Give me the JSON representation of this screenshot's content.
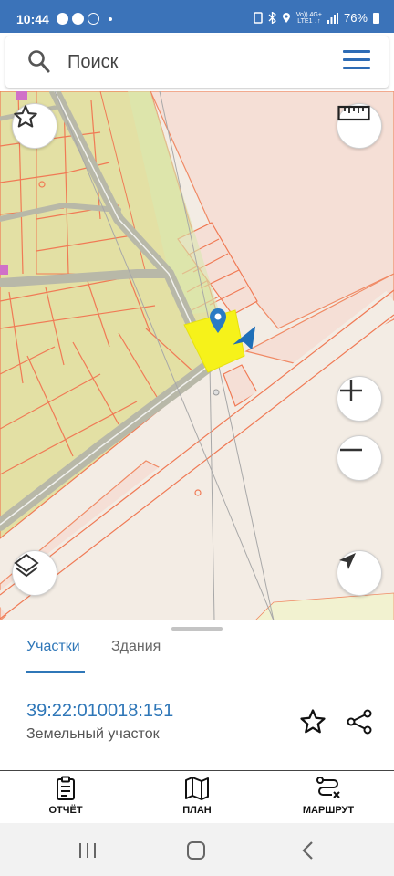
{
  "status_bar": {
    "time": "10:44",
    "lte_top": "Vo)) 4G+",
    "lte_bottom": "LTE1 ↓↑",
    "battery": "76%"
  },
  "search": {
    "placeholder": "Поиск"
  },
  "map": {
    "buttons": {
      "favorite": "star-icon",
      "ruler": "ruler-icon",
      "zoom_in": "plus-icon",
      "zoom_out": "minus-icon",
      "layers": "layers-icon",
      "my_location": "navigation-arrow-icon"
    },
    "colors": {
      "parcel_fill": "#e3e0a4",
      "parcel_border": "#f07a55",
      "road": "#b8b8a8",
      "selected_parcel": "#f6f21a",
      "pin": "#2a7bc4"
    }
  },
  "sheet": {
    "tabs": [
      {
        "label": "Участки",
        "active": true
      },
      {
        "label": "Здания",
        "active": false
      }
    ],
    "parcel": {
      "number": "39:22:010018:151",
      "type": "Земельный участок"
    },
    "actions": [
      {
        "label": "ОТЧЁТ",
        "icon": "report-icon"
      },
      {
        "label": "ПЛАН",
        "icon": "map-plan-icon"
      },
      {
        "label": "МАРШРУТ",
        "icon": "route-icon"
      }
    ]
  }
}
